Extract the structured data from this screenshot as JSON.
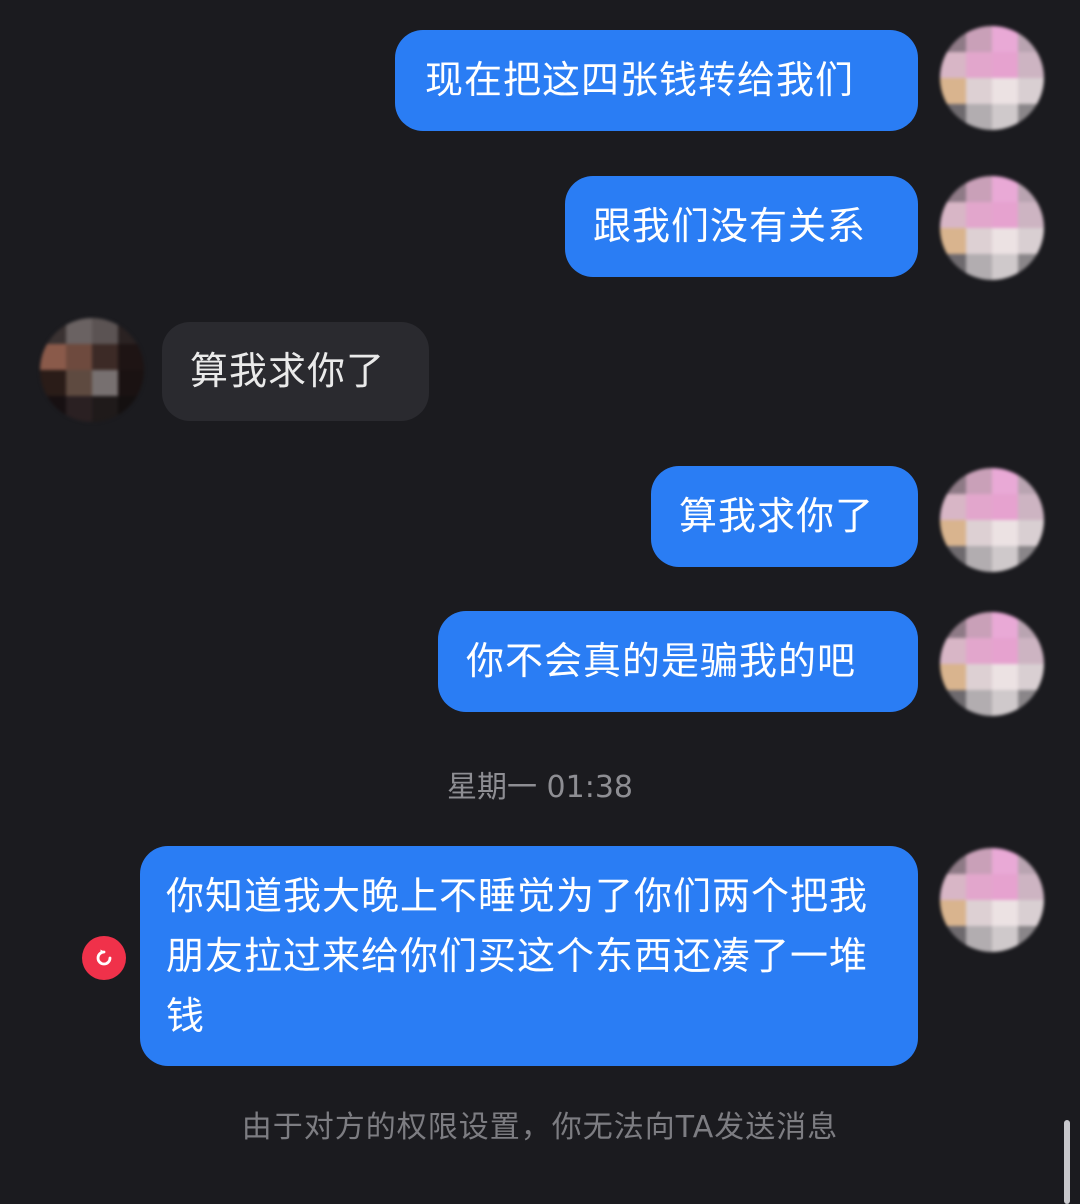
{
  "conversation": {
    "messages": [
      {
        "direction": "outgoing",
        "text": "现在把这四张钱转给我们"
      },
      {
        "direction": "outgoing",
        "text": "跟我们没有关系"
      },
      {
        "direction": "incoming",
        "text": "算我求你了"
      },
      {
        "direction": "outgoing",
        "text": "算我求你了"
      },
      {
        "direction": "outgoing",
        "text": "你不会真的是骗我的吧"
      },
      {
        "direction": "outgoing",
        "text": "你知道我大晚上不睡觉为了你们两个把我朋友拉过来给你们买这个东西还凑了一堆钱",
        "status": "failed"
      }
    ],
    "timestamp": "星期一 01:38",
    "blocked_notice": "由于对方的权限设置，你无法向TA发送消息"
  },
  "colors": {
    "background": "#1b1b1f",
    "outgoing_bubble": "#2a7df4",
    "incoming_bubble": "#2a2a2f",
    "failed_indicator": "#f0314a",
    "muted_text": "#8e8e93"
  },
  "icons": {
    "failed_send": "resend-icon",
    "self_avatar": "pixelated-avatar-self",
    "peer_avatar": "pixelated-avatar-peer"
  }
}
